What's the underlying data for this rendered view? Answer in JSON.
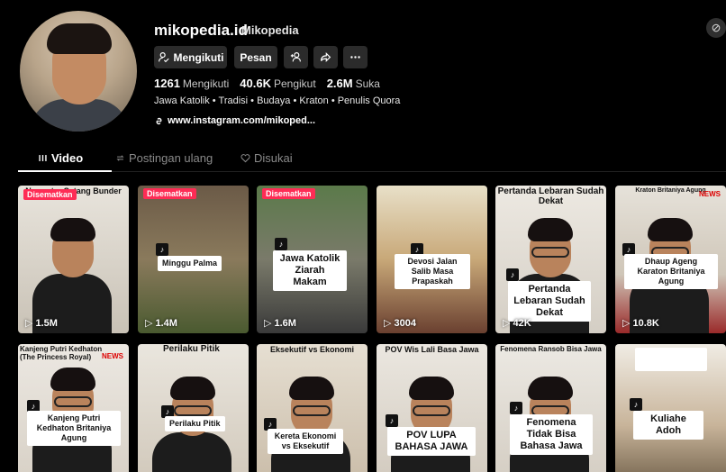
{
  "profile": {
    "username": "mikopedia.id",
    "nickname": "Mikopedia",
    "buttons": {
      "follow": "Mengikuti",
      "message": "Pesan"
    },
    "stats": {
      "following_value": "1261",
      "following_label": "Mengikuti",
      "followers_value": "40.6K",
      "followers_label": "Pengikut",
      "likes_value": "2.6M",
      "likes_label": "Suka"
    },
    "bio": "Jawa Katolik • Tradisi • Budaya • Kraton • Penulis Quora",
    "link": "www.instagram.com/mikoped..."
  },
  "tabs": [
    {
      "label": "Video"
    },
    {
      "label": "Postingan ulang"
    },
    {
      "label": "Disukai"
    }
  ],
  "videos": [
    {
      "top": "Nggontre Setang Bunder",
      "pinned": "Disematkan",
      "caption": "",
      "views": "1.5M"
    },
    {
      "top": "",
      "pinned": "Disematkan",
      "caption": "Minggu Palma",
      "views": "1.4M"
    },
    {
      "top": "",
      "pinned": "Disematkan",
      "caption": "Jawa Katolik Ziarah Makam",
      "views": "1.6M"
    },
    {
      "top": "",
      "pinned": "",
      "caption": "Devosi Jalan Salib Masa Prapaskah",
      "views": "3004"
    },
    {
      "top": "Pertanda Lebaran Sudah Dekat",
      "pinned": "",
      "caption": "Pertanda Lebaran Sudah Dekat",
      "views": "42K"
    },
    {
      "top": "Kraton Britaniya Agung",
      "pinned": "",
      "caption": "Dhaup Ageng Karaton Britaniya Agung",
      "views": "10.8K",
      "news": "NEWS"
    },
    {
      "top": "Kanjeng Putri Kedhaton (The Princess Royal)",
      "pinned": "",
      "caption": "Kanjeng Putri Kedhaton Britaniya Agung",
      "views": "",
      "news": "NEWS"
    },
    {
      "top": "Perilaku Pitik",
      "pinned": "",
      "caption": "Perilaku Pitik",
      "views": ""
    },
    {
      "top": "Eksekutif vs Ekonomi",
      "pinned": "",
      "caption": "Kereta Ekonomi vs Eksekutif",
      "views": ""
    },
    {
      "top": "POV Wis Lali Basa Jawa",
      "pinned": "",
      "caption": "POV LUPA BAHASA JAWA",
      "views": ""
    },
    {
      "top": "Fenomena Ransob Bisa Jawa",
      "pinned": "",
      "caption": "Fenomena Tidak Bisa Bahasa Jawa",
      "views": ""
    },
    {
      "top": "",
      "pinned": "",
      "caption": "Kuliahe Adoh",
      "views": ""
    }
  ],
  "colors": {
    "background": "#000000",
    "button": "#2b2b2b",
    "pinned": "#fe2c55"
  }
}
